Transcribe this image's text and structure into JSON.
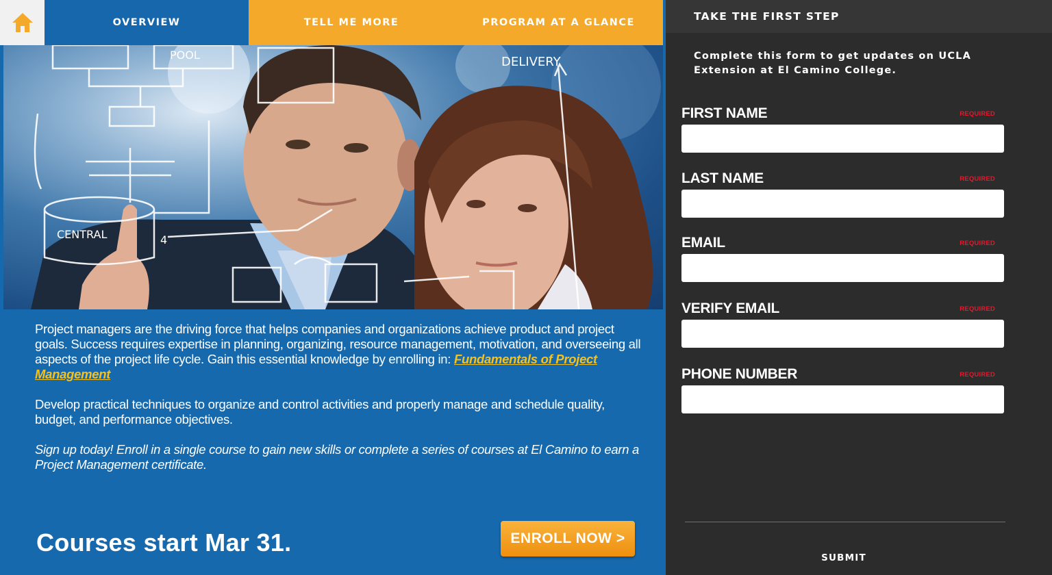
{
  "nav": {
    "home_icon": "home-icon",
    "tabs": [
      {
        "label": "OVERVIEW"
      },
      {
        "label": "TELL ME MORE"
      },
      {
        "label": "PROGRAM AT A GLANCE"
      }
    ]
  },
  "hero": {
    "sketch_text": [
      "POOL",
      "DELIVERY",
      "CENTRAL",
      "4"
    ]
  },
  "content": {
    "intro": "Project managers are the driving force that helps companies and organizations achieve product and project goals. Success requires expertise in planning, organizing, resource management, motivation, and overseeing all aspects of the project life cycle. Gain this essential knowledge by enrolling in: ",
    "course_link": "Fundamentals of Project Management",
    "practical": "Develop practical techniques to organize and control activities and properly manage and schedule quality, budget, and performance objectives.",
    "signup": "Sign up today! Enroll in a single course to gain new skills or complete a series of courses at El Camino to earn a Project Management certificate.",
    "courses_start": "Courses start Mar 31.",
    "enroll_label": "ENROLL NOW >"
  },
  "form": {
    "title": "TAKE THE FIRST STEP",
    "intro": "Complete this form to get updates on UCLA Extension at El Camino College.",
    "fields": [
      {
        "label": "FIRST NAME",
        "required": "REQUIRED",
        "value": ""
      },
      {
        "label": "LAST NAME",
        "required": "REQUIRED",
        "value": ""
      },
      {
        "label": "EMAIL",
        "required": "REQUIRED",
        "value": ""
      },
      {
        "label": "VERIFY EMAIL",
        "required": "REQUIRED",
        "value": ""
      },
      {
        "label": "PHONE NUMBER",
        "required": "REQUIRED",
        "value": ""
      }
    ],
    "submit_label": "SUBMIT"
  },
  "colors": {
    "blue": "#1669ad",
    "orange": "#f4a92a",
    "panel": "#2c2c2d",
    "link": "#f6c11b",
    "required": "#e4182a"
  }
}
